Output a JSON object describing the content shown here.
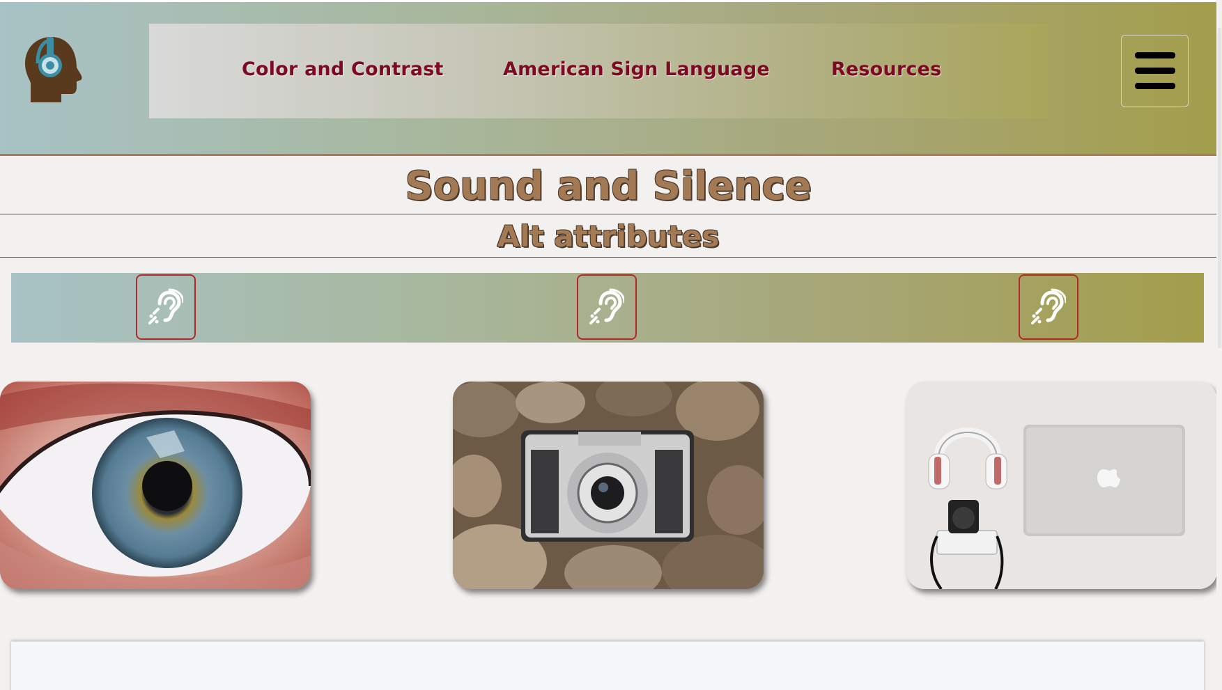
{
  "nav": {
    "logo_icon": "head-with-headphones-icon",
    "links": [
      {
        "label": "Color and Contrast"
      },
      {
        "label": "American Sign Language"
      },
      {
        "label": "Resources"
      }
    ],
    "menu_icon": "hamburger-menu-icon"
  },
  "page": {
    "title": "Sound and Silence",
    "subtitle": "Alt attributes"
  },
  "audio_buttons": [
    {
      "icon": "hearing-assist-icon"
    },
    {
      "icon": "hearing-assist-icon"
    },
    {
      "icon": "hearing-assist-icon"
    }
  ],
  "images": [
    {
      "subject": "eye"
    },
    {
      "subject": "camera"
    },
    {
      "subject": "headphones-laptop-camera"
    }
  ],
  "colors": {
    "nav_link": "#7d0a22",
    "title": "#a47a55",
    "audio_button_border": "#b22828",
    "header_border": "#a97b5d"
  }
}
